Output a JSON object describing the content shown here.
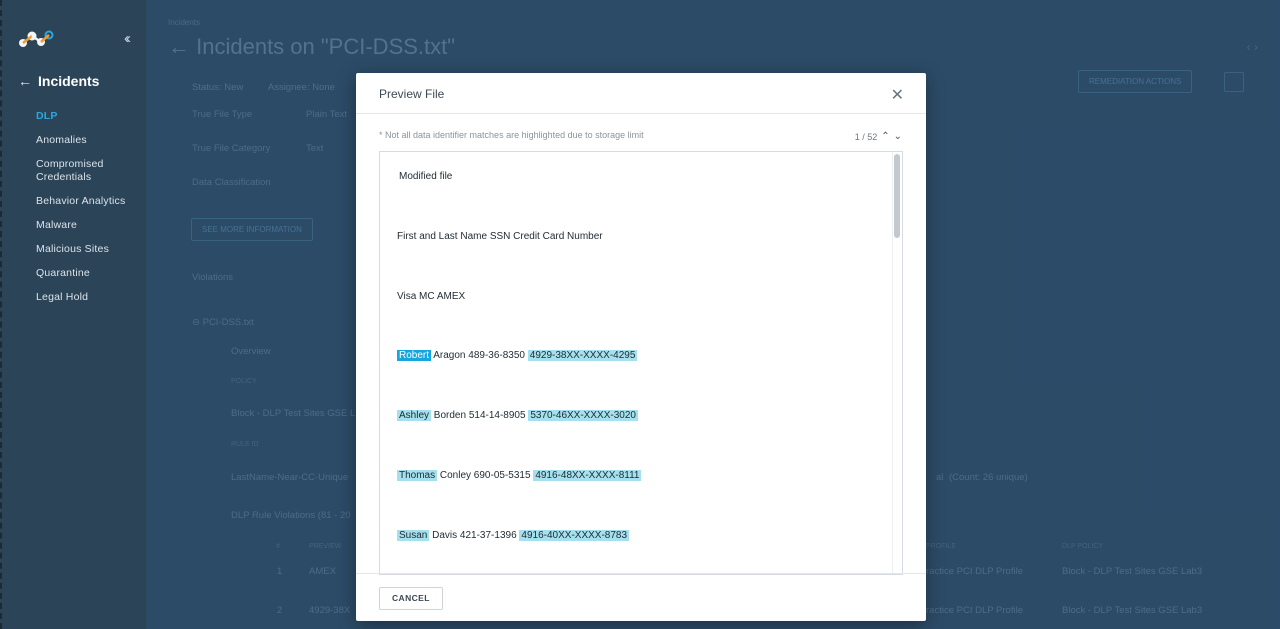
{
  "sidebar": {
    "title": "Incidents",
    "items": [
      {
        "label": "DLP",
        "active": true
      },
      {
        "label": "Anomalies"
      },
      {
        "label": "Compromised Credentials"
      },
      {
        "label": "Behavior Analytics"
      },
      {
        "label": "Malware"
      },
      {
        "label": "Malicious Sites"
      },
      {
        "label": "Quarantine"
      },
      {
        "label": "Legal Hold"
      }
    ]
  },
  "page": {
    "breadcrumb": "Incidents",
    "title": "Incidents on \"PCI-DSS.txt\"",
    "status": "Status: New",
    "assignee": "Assignee: None",
    "true_file_type_label": "True File Type",
    "true_file_type_value": "Plain Text",
    "true_file_category_label": "True File Category",
    "true_file_category_value": "Text",
    "data_classification_label": "Data Classification",
    "see_more_button": "SEE MORE INFORMATION",
    "remediation_button": "REMEDIATION ACTIONS",
    "violations_label": "Violations",
    "file_entry": "PCI-DSS.txt",
    "overview_label": "Overview",
    "policy_header": "POLICY",
    "policy_value": "Block - DLP Test Sites GSE L",
    "rule_header": "RULE ID",
    "rule_value": "LastName-Near-CC-Unique",
    "rule_violations": "DLP Rule Violations (81 - 20",
    "col_num": "#",
    "col_preview": "PREVIEW",
    "col_profile": "PROFILE",
    "col_dlp_policy": "DLP POLICY",
    "rows": [
      {
        "num": "1",
        "preview": "AMEX",
        "profile": "ractice PCI DLP Profile",
        "policy": "Block - DLP Test Sites GSE Lab3"
      },
      {
        "num": "2",
        "preview": "4929-38X",
        "profile": "ractice PCI DLP Profile",
        "policy": "Block - DLP Test Sites GSE Lab3"
      }
    ],
    "right_severity": "al",
    "right_count": "(Count: 26 unique)"
  },
  "modal": {
    "title": "Preview File",
    "note": "* Not all data identifier matches are highlighted due to storage limit",
    "pager_text": "1 / 52",
    "lines": [
      {
        "pre": "Modified file"
      },
      {
        "pre": "First and Last Name SSN Credit Card Number"
      },
      {
        "pre": "Visa MC AMEX"
      },
      {
        "name": "Robert",
        "mid": " Aragon 489-36-8350 ",
        "card": "4929-38XX-XXXX-4295"
      },
      {
        "name": "Ashley",
        "mid": " Borden 514-14-8905 ",
        "card": "5370-46XX-XXXX-3020"
      },
      {
        "name": "Thomas",
        "mid": " Conley 690-05-5315 ",
        "card": "4916-48XX-XXXX-8111"
      },
      {
        "name": "Susan",
        "mid": " Davis 421-37-1396 ",
        "card": "4916-40XX-XXXX-8783"
      }
    ],
    "cancel_label": "CANCEL"
  },
  "colors": {
    "accent": "#13a7de",
    "highlight": "#a4e0ee",
    "sidebar_bg": "#2b4457",
    "page_bg": "#2f4f6c"
  }
}
